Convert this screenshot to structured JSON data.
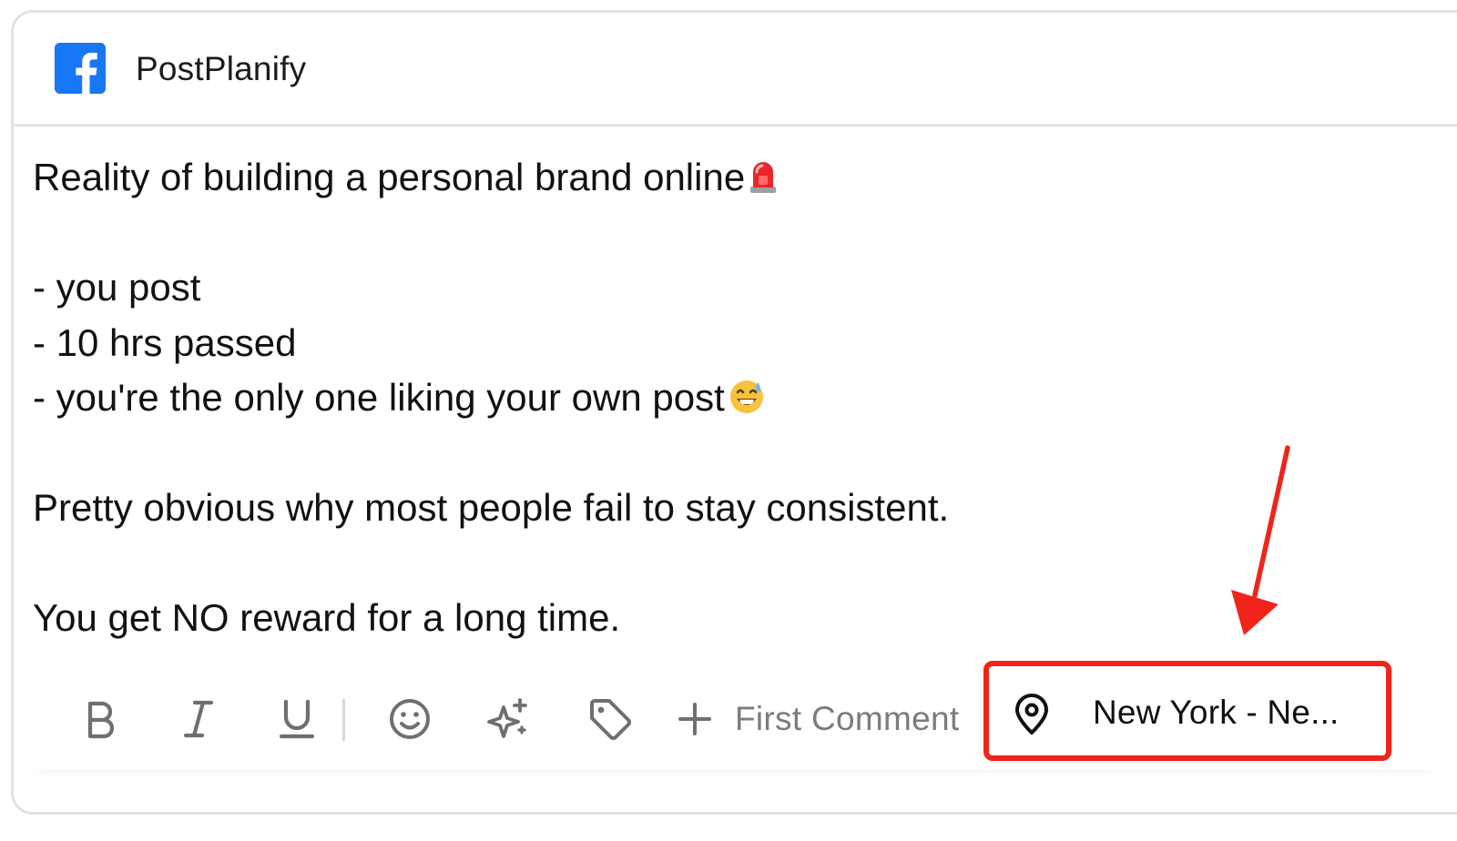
{
  "account": {
    "platform_icon": "facebook-icon",
    "name": "PostPlanify"
  },
  "post": {
    "lines": [
      "Reality of building a personal brand online",
      "",
      "- you post",
      "- 10 hrs passed",
      "- you're the only one liking your own post",
      "",
      "Pretty obvious why most people fail to stay consistent.",
      "",
      "You get NO reward for a long time."
    ],
    "emojis": {
      "line_0": "police-car-light-emoji",
      "line_4": "grinning-sweat-emoji"
    }
  },
  "toolbar": {
    "tools": [
      {
        "name": "bold-icon"
      },
      {
        "name": "italic-icon"
      },
      {
        "name": "underline-icon"
      },
      {
        "name": "emoji-icon"
      },
      {
        "name": "ai-sparkle-icon"
      },
      {
        "name": "tag-icon"
      }
    ],
    "first_comment": {
      "icon": "plus-icon",
      "label": "First Comment"
    },
    "location": {
      "icon": "map-pin-icon",
      "label": "New York - Ne..."
    }
  },
  "annotation": {
    "highlight_color": "#f0241b",
    "arrow_color": "#f0241b"
  },
  "colors": {
    "facebook_blue": "#1877f2",
    "toolbar_icon": "#6e6e73",
    "muted_text": "#7b7b80"
  }
}
